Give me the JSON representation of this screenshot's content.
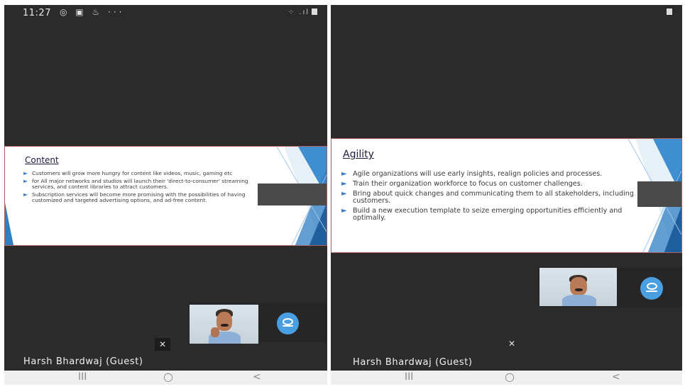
{
  "left": {
    "status": {
      "time": "11:27",
      "icons": "◎ ▣ ♨ ···",
      "right": "⁘ .ıl"
    },
    "slide": {
      "title": "Content",
      "bullets": [
        "Customers will grow more hungry for content like videos, music, gaming etc",
        "for All major networks and studios will launch their 'direct-to-consumer' streaming services, and content libraries to attract customers.",
        "Subscription services will become more promising with the possibilities of having customized and targeted advertising options, and ad-free content."
      ]
    },
    "participant_name": "Harsh Bhardwaj (Guest)"
  },
  "right": {
    "slide": {
      "title": "Agility",
      "bullets": [
        "Agile organizations will use early insights, realign policies and processes.",
        "Train their organization workforce to focus on customer challenges.",
        "Bring about quick changes and communicating them to all stakeholders, including customers.",
        "Build a new execution template to seize emerging opportunities efficiently and optimally."
      ]
    },
    "participant_name": "Harsh Bhardwaj (Guest)"
  },
  "icons": {
    "bullet": "►",
    "mic_muted": "✕",
    "nav_recents": "III",
    "nav_home": "○",
    "nav_back": "<"
  },
  "colors": {
    "accent_blue": "#4a9fe0",
    "bullet_blue": "#3b7fc4",
    "background": "#2b2b2b"
  }
}
